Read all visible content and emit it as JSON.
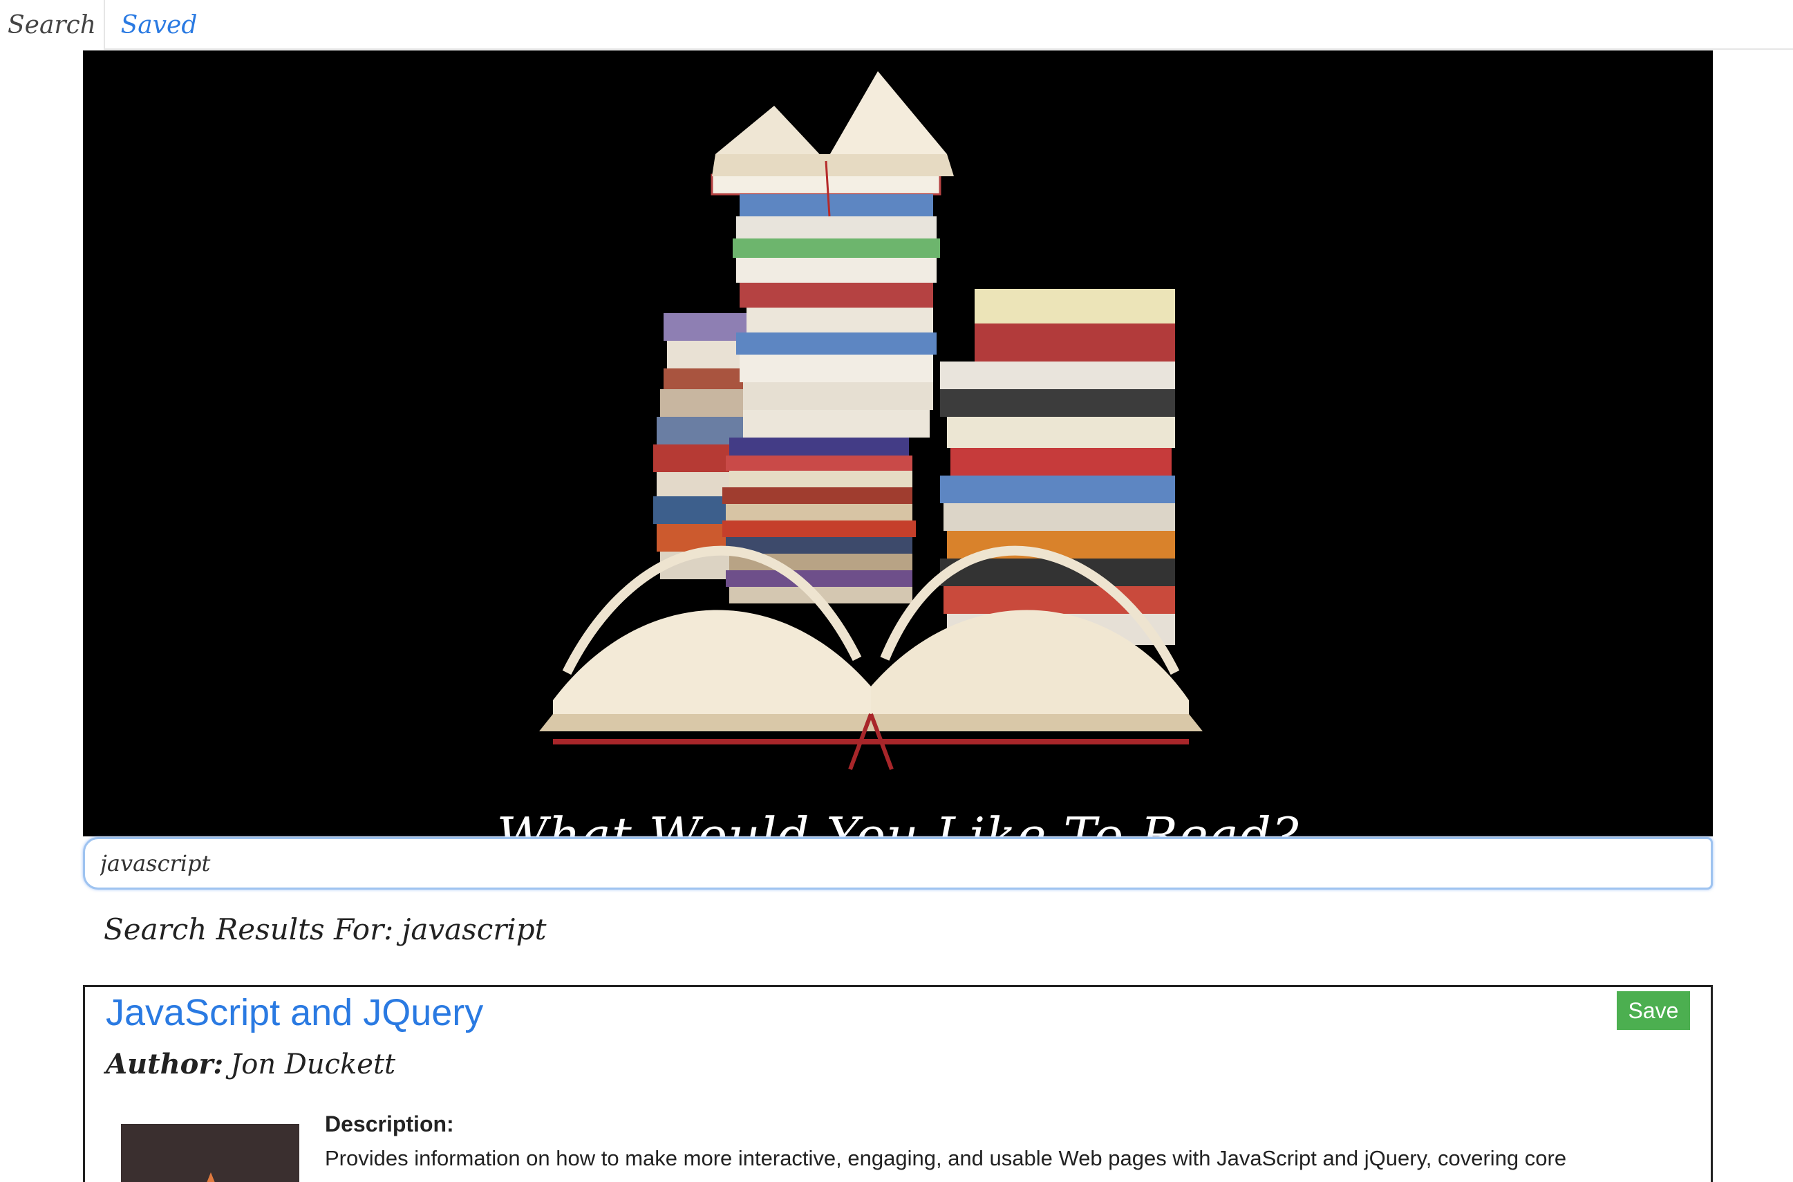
{
  "nav": {
    "tabs": [
      {
        "label": "Search"
      },
      {
        "label": "Saved"
      }
    ]
  },
  "hero": {
    "title": "What Would You Like To Read?"
  },
  "search": {
    "value": "javascript"
  },
  "results": {
    "heading_label": "Search Results For:",
    "query": "javascript",
    "items": [
      {
        "title": "JavaScript and JQuery",
        "author_label": "Author:",
        "author": "Jon Duckett",
        "save_label": "Save",
        "description_label": "Description:",
        "description": "Provides information on how to make more interactive, engaging, and usable Web pages with JavaScript and jQuery, covering core"
      }
    ]
  },
  "colors": {
    "link": "#2a7ae2",
    "save_button": "#4caf50",
    "hero_background": "#000000"
  }
}
